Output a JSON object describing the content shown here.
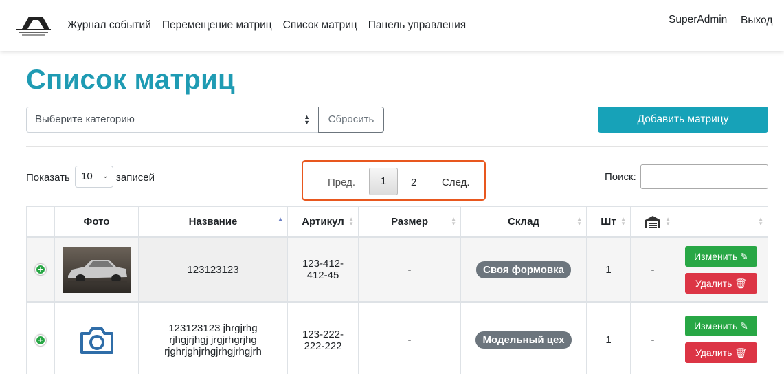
{
  "nav": {
    "links": [
      "Журнал событий",
      "Перемещение матриц",
      "Список матриц",
      "Панель управления"
    ],
    "user": "SuperAdmin",
    "logout": "Выход"
  },
  "page": {
    "title": "Список матриц"
  },
  "filters": {
    "category_placeholder": "Выберите категорию",
    "reset": "Сбросить",
    "add": "Добавить матрицу"
  },
  "table_controls": {
    "show": "Показать",
    "length": "10",
    "records": "записей",
    "prev": "Пред.",
    "pages": [
      "1",
      "2"
    ],
    "current_page": "1",
    "next": "След.",
    "search": "Поиск:"
  },
  "table": {
    "headers": [
      "",
      "Фото",
      "Название",
      "Артикул",
      "Размер",
      "Склад",
      "Шт",
      "",
      ""
    ],
    "rows": [
      {
        "photo": "car-photo",
        "name": "123123123",
        "article_line1": "123-412-",
        "article_line2": "412-45",
        "size": "-",
        "warehouse": "Своя формовка",
        "qty": "1",
        "garage": "-",
        "edit": "Изменить",
        "delete": "Удалить"
      },
      {
        "photo": "camera-icon",
        "name_line1": "123123123 jhrgjrhg",
        "name_line2": "rjhgjrjhgj jrgjrhgrjhg",
        "name_line3": "rjghrjghjrhgjrhgjrhgjrh",
        "article_line1": "123-222-",
        "article_line2": "222-222",
        "size": "-",
        "warehouse": "Модельный цех",
        "qty": "1",
        "garage": "-",
        "edit": "Изменить",
        "delete": "Удалить"
      }
    ]
  },
  "colors": {
    "title": "#1f9bb3",
    "add_button": "#17a2b8",
    "edit_button": "#28a745",
    "delete_button": "#dc3545",
    "badge": "#6c757d",
    "pager_highlight": "#e8571e"
  }
}
